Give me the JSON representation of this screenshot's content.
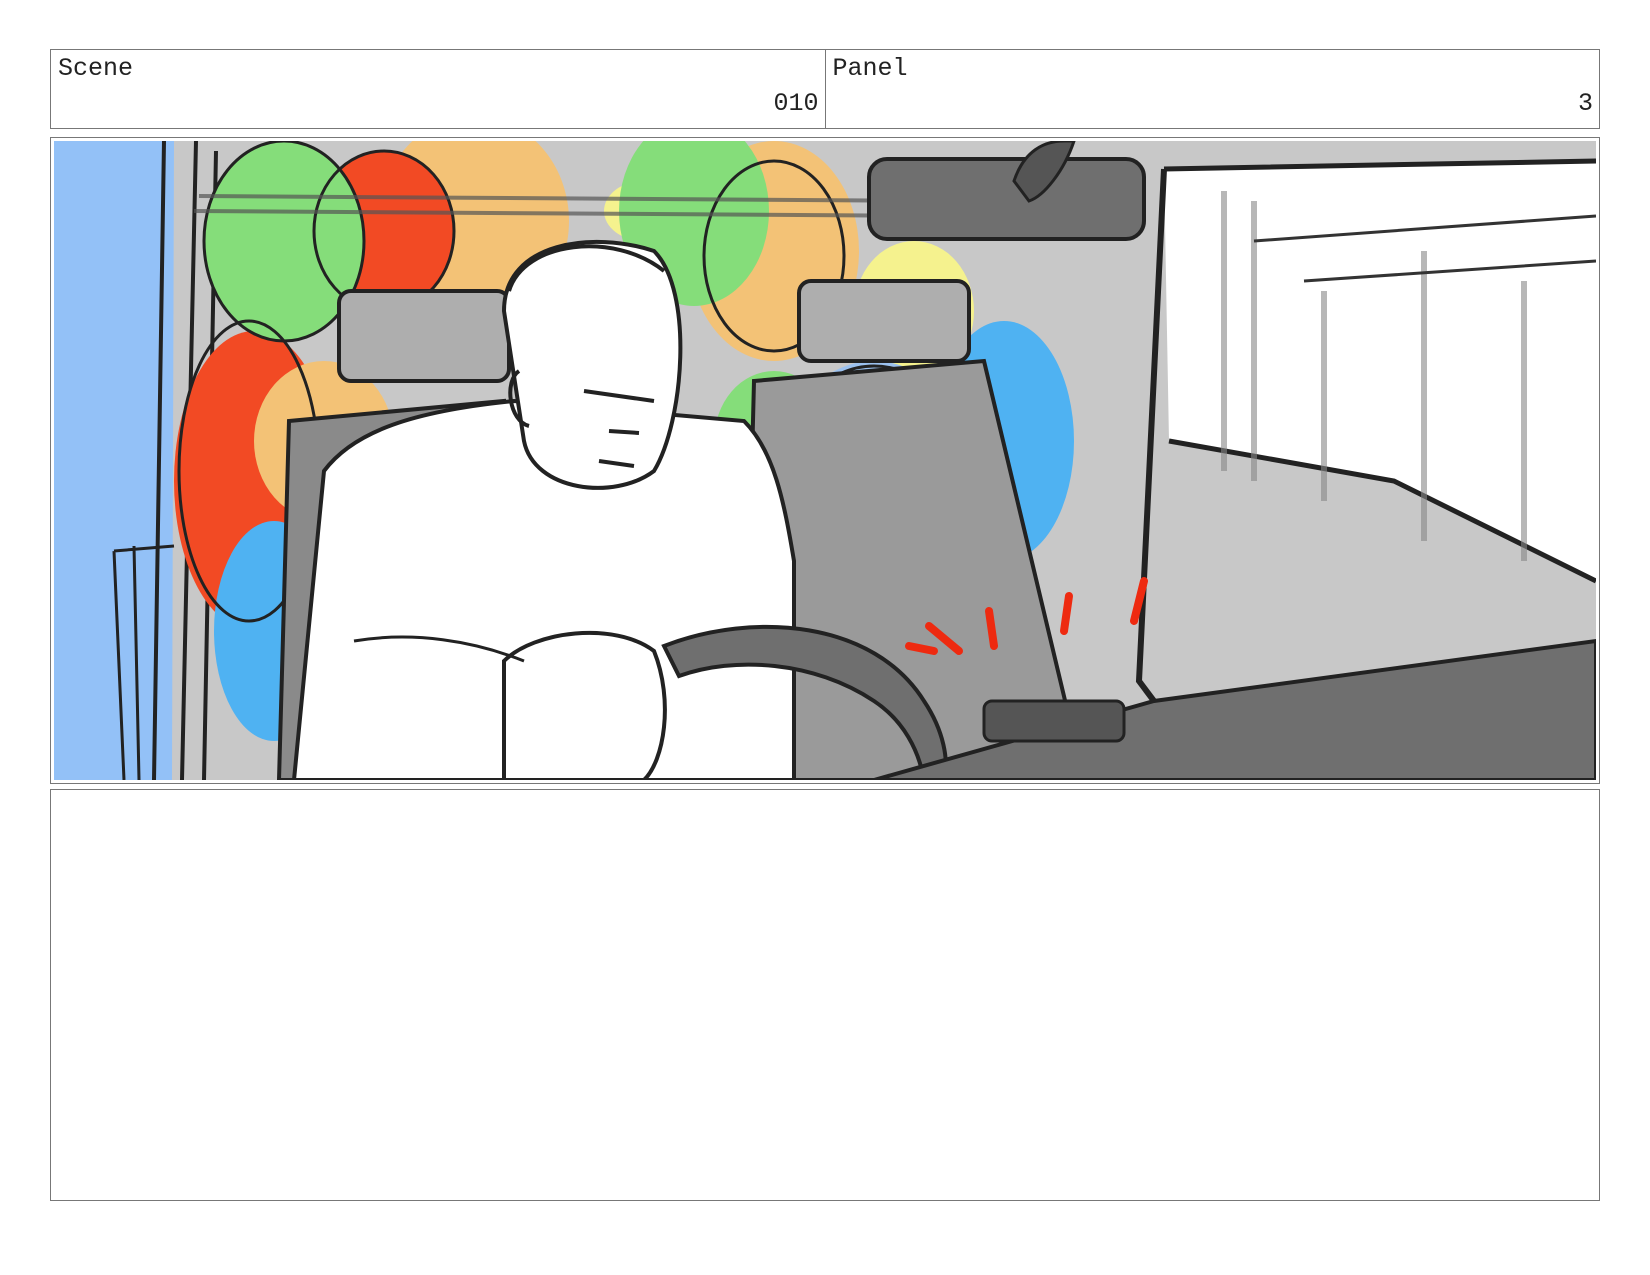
{
  "scene": {
    "label": "Scene",
    "value": "010"
  },
  "panel": {
    "label": "Panel",
    "value": "3"
  },
  "notes": {
    "text": ""
  },
  "colors": {
    "sky": "#93c1f7",
    "interior_gray": "#c8c8c8",
    "dark_gray": "#6f6f6f",
    "balloon_green": "#85dd7a",
    "balloon_red": "#f24a24",
    "balloon_orange": "#f3c276",
    "balloon_yellow": "#f5f28e",
    "balloon_blue": "#4fb2f2",
    "balloon_light_blue": "#9cc1ee",
    "accent_red": "#ee2a10"
  }
}
